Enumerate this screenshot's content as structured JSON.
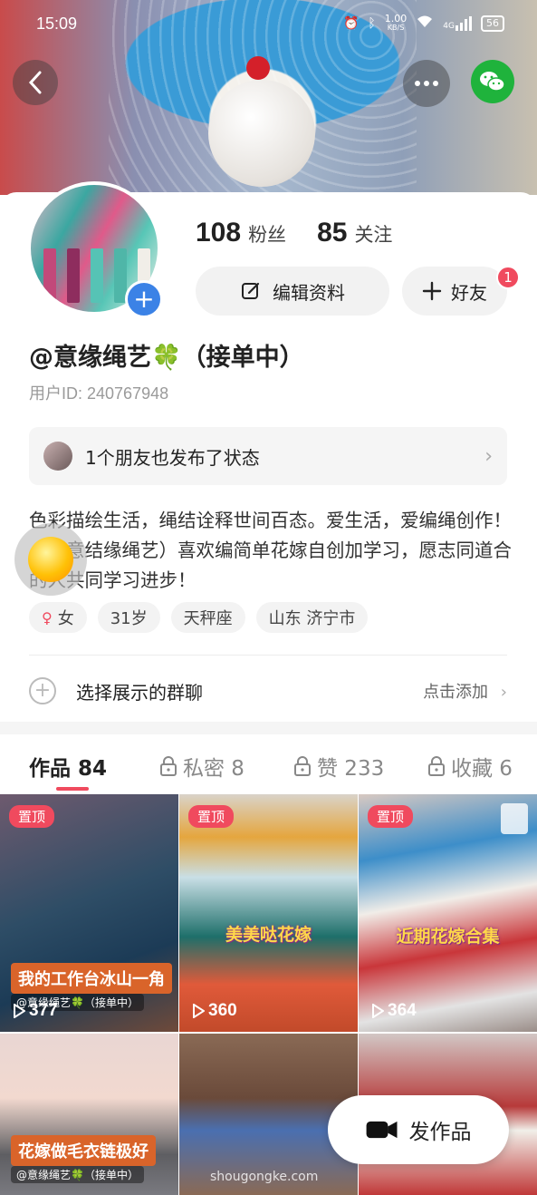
{
  "status_bar": {
    "time": "15:09",
    "net_speed": "1.00",
    "net_unit": "KB/S",
    "network": "4G",
    "battery": "56"
  },
  "profile": {
    "fans_count": "108",
    "fans_label": "粉丝",
    "follow_count": "85",
    "follow_label": "关注",
    "edit_label": "编辑资料",
    "friend_label": "好友",
    "friend_badge": "1",
    "name": "@意缘绳艺🍀（接单中）",
    "user_id": "用户ID: 240767948",
    "friends_status": "1个朋友也发布了状态",
    "bio": "色彩描绘生活，绳结诠释世间百态。爱生活，爱编绳创作！（创意结缘绳艺）喜欢编简单花嫁自创加学习，愿志同道合的人共同学习进步！",
    "tags": [
      "女",
      "31岁",
      "天秤座",
      "山东 济宁市"
    ],
    "group_label": "选择展示的群聊",
    "group_action": "点击添加"
  },
  "tabs": [
    {
      "label": "作品 84",
      "locked": false
    },
    {
      "label": "私密 8",
      "locked": true
    },
    {
      "label": "赞 233",
      "locked": true
    },
    {
      "label": "收藏 6",
      "locked": true
    }
  ],
  "grid": [
    {
      "pin": "置顶",
      "views": "377",
      "title": "我的工作台冰山一角",
      "watermark": "@意缘绳艺🍀（接单中）"
    },
    {
      "pin": "置顶",
      "views": "360",
      "overlay": "美美哒花嫁"
    },
    {
      "pin": "置顶",
      "views": "364",
      "overlay": "近期花嫁合集"
    },
    {
      "title": "花嫁做毛衣链极好",
      "watermark": "@意缘绳艺🍀（接单中）"
    },
    {},
    {}
  ],
  "publish_label": "发作品",
  "site_mark": "shougongke.com",
  "colors": {
    "accent": "#f04a5e",
    "wechat": "#1fb33c",
    "avatar_add": "#3b82e6"
  }
}
